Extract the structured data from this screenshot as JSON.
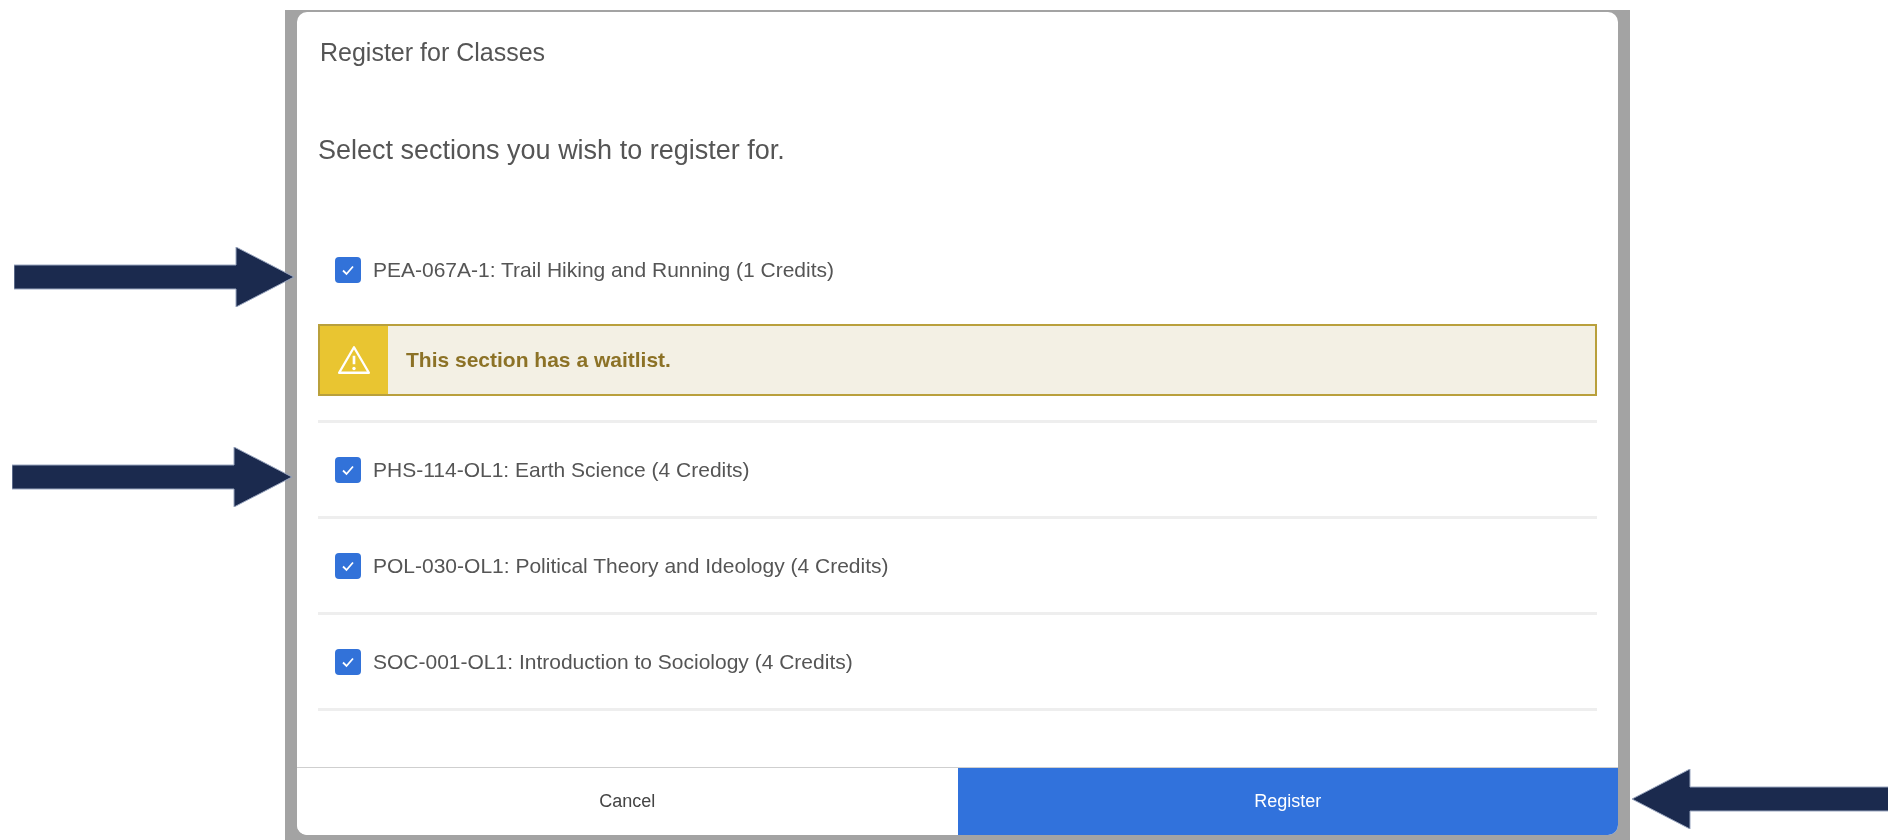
{
  "dialog": {
    "title": "Register for Classes",
    "instruction": "Select sections you wish to register for.",
    "sections": [
      {
        "label": "PEA-067A-1: Trail Hiking and Running (1 Credits)",
        "checked": true,
        "alert": "This section has a waitlist."
      },
      {
        "label": "PHS-114-OL1: Earth Science (4 Credits)",
        "checked": true
      },
      {
        "label": "POL-030-OL1: Political Theory and Ideology (4 Credits)",
        "checked": true
      },
      {
        "label": "SOC-001-OL1: Introduction to Sociology (4 Credits)",
        "checked": true
      }
    ],
    "buttons": [
      {
        "label": "Cancel",
        "kind": "secondary"
      },
      {
        "label": "Register",
        "kind": "primary"
      }
    ]
  }
}
